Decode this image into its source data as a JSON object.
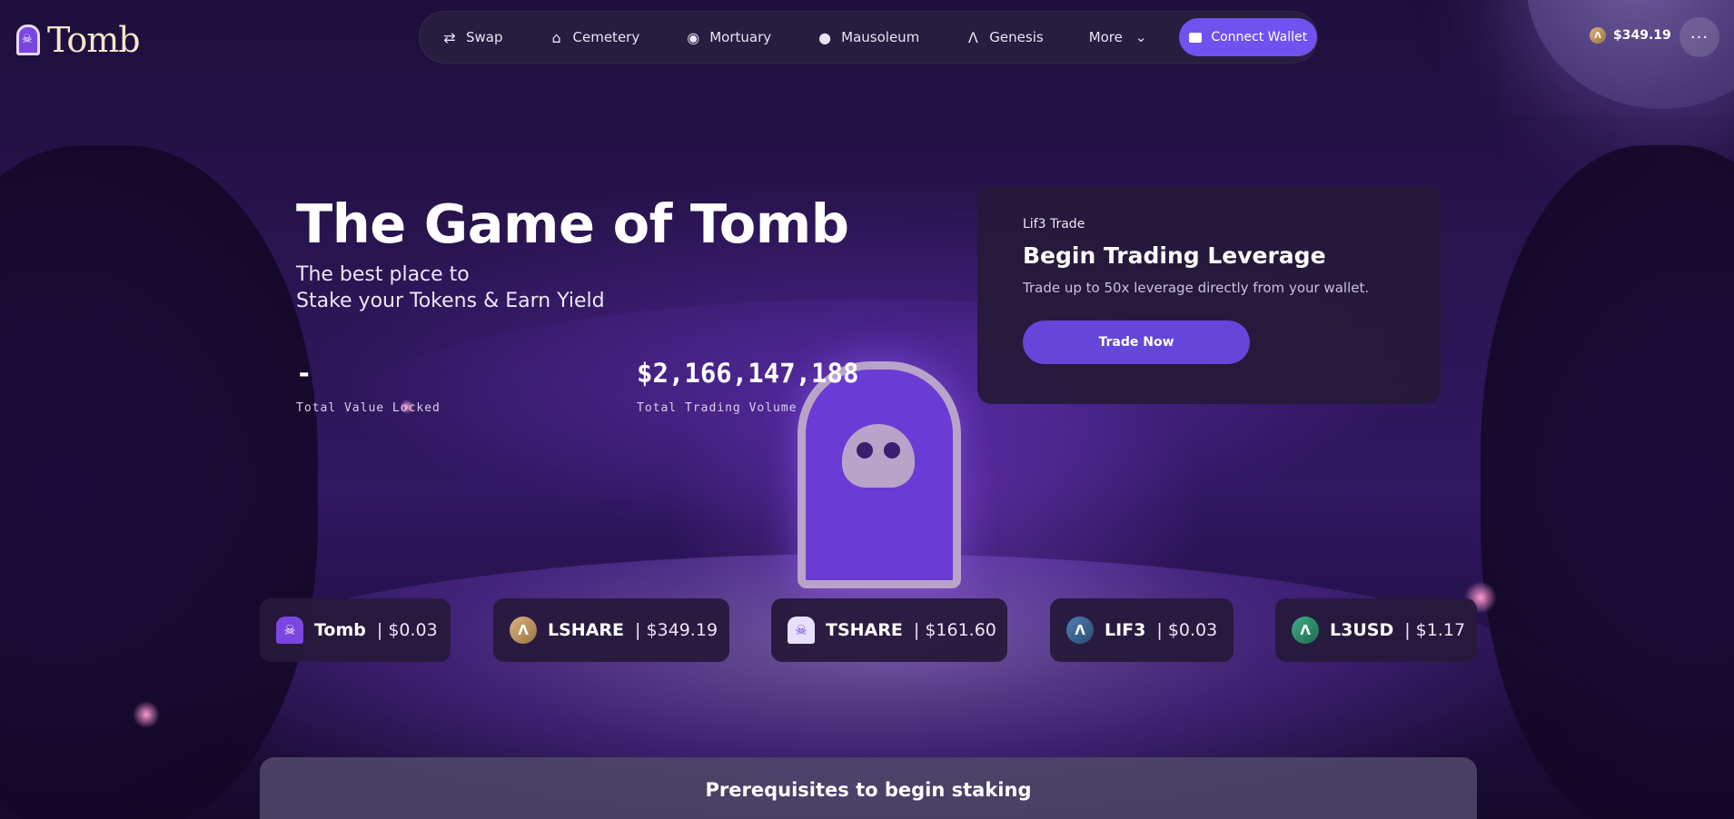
{
  "brand": {
    "name": "Tomb"
  },
  "nav": {
    "items": [
      {
        "label": "Swap",
        "icon": "swap-icon"
      },
      {
        "label": "Cemetery",
        "icon": "cemetery-icon"
      },
      {
        "label": "Mortuary",
        "icon": "mortuary-icon"
      },
      {
        "label": "Mausoleum",
        "icon": "mausoleum-icon"
      },
      {
        "label": "Genesis",
        "icon": "genesis-icon"
      }
    ],
    "more_label": "More",
    "connect_label": "Connect Wallet"
  },
  "header_price": {
    "value": "$349.19",
    "icon": "lshare-coin-icon"
  },
  "hero": {
    "title": "The Game of Tomb",
    "subtitle_line1": "The best place to",
    "subtitle_line2": "Stake your Tokens & Earn Yield",
    "stats": [
      {
        "value": "-",
        "label": "Total Value Locked"
      },
      {
        "value": "$2,166,147,188",
        "label": "Total Trading Volume"
      }
    ]
  },
  "promo": {
    "kicker": "Lif3 Trade",
    "title": "Begin Trading Leverage",
    "description": "Trade up to 50x leverage directly from your wallet.",
    "button_label": "Trade Now"
  },
  "tokens": [
    {
      "name": "Tomb",
      "price": "| $0.03",
      "color": "#7a45e0"
    },
    {
      "name": "LSHARE",
      "price": "| $349.19",
      "color": "#b58a5a"
    },
    {
      "name": "TSHARE",
      "price": "| $161.60",
      "color": "#8a6ad0"
    },
    {
      "name": "LIF3",
      "price": "| $0.03",
      "color": "#3a5f8a"
    },
    {
      "name": "L3USD",
      "price": "| $1.17",
      "color": "#2e8a6a"
    }
  ],
  "prerequisites": {
    "title": "Prerequisites to begin staking"
  },
  "colors": {
    "accent": "#6f52f0",
    "button": "#6446d8",
    "card": "#251a3a"
  }
}
